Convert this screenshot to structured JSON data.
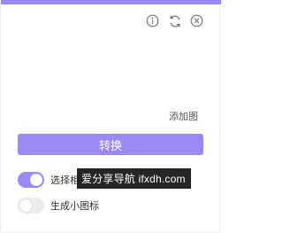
{
  "colors": {
    "accent": "#9b8af4",
    "icon_gray": "#777777",
    "switch_off": "#ececec"
  },
  "header": {
    "icons": [
      "info-icon",
      "refresh-icon",
      "close-icon"
    ]
  },
  "main": {
    "add_image_label": "添加图",
    "convert_label": "转换"
  },
  "options": [
    {
      "label": "选择相",
      "enabled": true
    },
    {
      "label": "生成小图标",
      "enabled": false
    }
  ],
  "watermark": {
    "text": "爱分享导航 ifxdh.com"
  }
}
